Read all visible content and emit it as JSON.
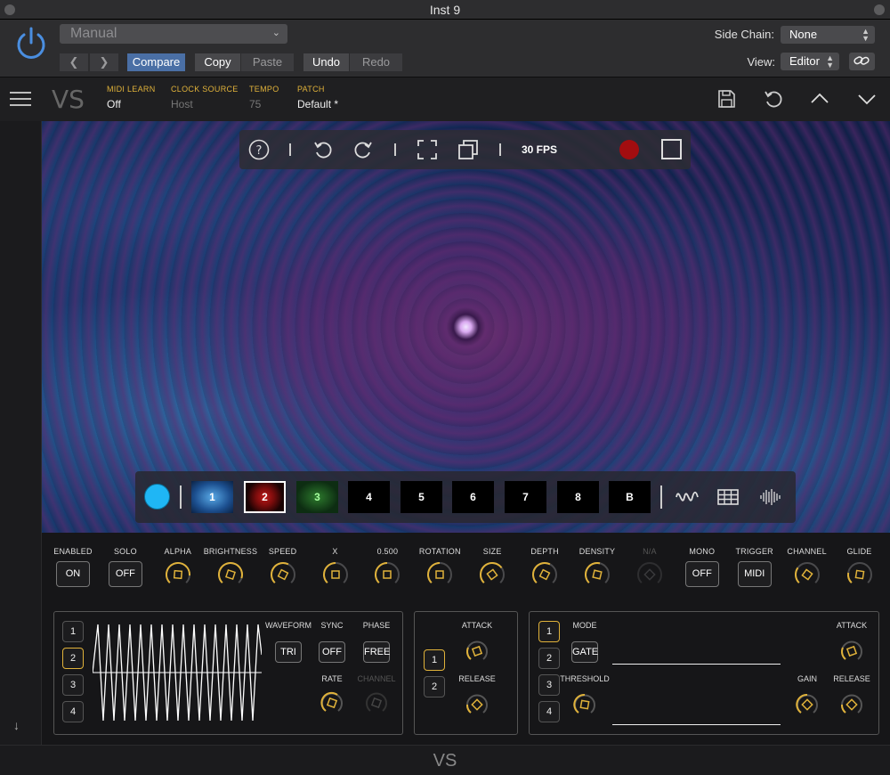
{
  "window": {
    "title": "Inst 9"
  },
  "host": {
    "preset": "Manual",
    "compare": "Compare",
    "copy": "Copy",
    "paste": "Paste",
    "undo": "Undo",
    "redo": "Redo",
    "side_chain_label": "Side Chain:",
    "side_chain_value": "None",
    "view_label": "View:",
    "view_value": "Editor"
  },
  "plugin": {
    "logo": "VS",
    "midi_learn": {
      "label": "MIDI LEARN",
      "value": "Off"
    },
    "clock_source": {
      "label": "CLOCK SOURCE",
      "value": "Host"
    },
    "tempo": {
      "label": "TEMPO",
      "value": "75"
    },
    "patch": {
      "label": "PATCH",
      "value": "Default *"
    }
  },
  "visual": {
    "fps": "30 FPS",
    "scenes": [
      "1",
      "2",
      "3",
      "4",
      "5",
      "6",
      "7",
      "8",
      "B"
    ],
    "selected_scene": "2",
    "color": "#1fb6f5"
  },
  "params": [
    {
      "label": "ENABLED",
      "type": "pill",
      "value": "ON"
    },
    {
      "label": "SOLO",
      "type": "pill",
      "value": "OFF"
    },
    {
      "label": "ALPHA",
      "type": "knob",
      "level": 0.85
    },
    {
      "label": "BRIGHTNESS",
      "type": "knob",
      "level": 0.9
    },
    {
      "label": "SPEED",
      "type": "knob",
      "level": 0.6
    },
    {
      "label": "X",
      "type": "knob",
      "level": 0.5
    },
    {
      "label": "0.500",
      "type": "knob",
      "level": 0.5
    },
    {
      "label": "ROTATION",
      "type": "knob",
      "level": 0.5
    },
    {
      "label": "SIZE",
      "type": "knob",
      "level": 0.7
    },
    {
      "label": "DEPTH",
      "type": "knob",
      "level": 0.6
    },
    {
      "label": "DENSITY",
      "type": "knob",
      "level": 0.55
    },
    {
      "label": "N/A",
      "type": "knob",
      "level": 0.0,
      "disabled": true
    },
    {
      "label": "MONO",
      "type": "pill",
      "value": "OFF"
    },
    {
      "label": "TRIGGER",
      "type": "pill",
      "value": "MIDI"
    },
    {
      "label": "CHANNEL",
      "type": "knob",
      "level": 0.3
    },
    {
      "label": "GLIDE",
      "type": "knob",
      "level": 0.2
    }
  ],
  "lfo": {
    "slots": [
      "1",
      "2",
      "3",
      "4"
    ],
    "selected": "2",
    "waveform_label": "WAVEFORM",
    "waveform_value": "TRI",
    "sync_label": "SYNC",
    "sync_value": "OFF",
    "phase_label": "PHASE",
    "phase_value": "FREE",
    "rate_label": "RATE",
    "channel_label": "CHANNEL"
  },
  "envelope": {
    "slots": [
      "1",
      "2"
    ],
    "selected": "1",
    "attack_label": "ATTACK",
    "release_label": "RELEASE"
  },
  "gate": {
    "slots": [
      "1",
      "2",
      "3",
      "4"
    ],
    "selected": "1",
    "mode_label": "MODE",
    "mode_value": "GATE",
    "threshold_label": "THRESHOLD",
    "attack_label": "ATTACK",
    "gain_label": "GAIN",
    "release_label": "RELEASE"
  },
  "footer": {
    "logo": "VS"
  },
  "colors": {
    "accent": "#e0b23a",
    "host_active": "#4a6fa5",
    "record": "#a30d10"
  }
}
